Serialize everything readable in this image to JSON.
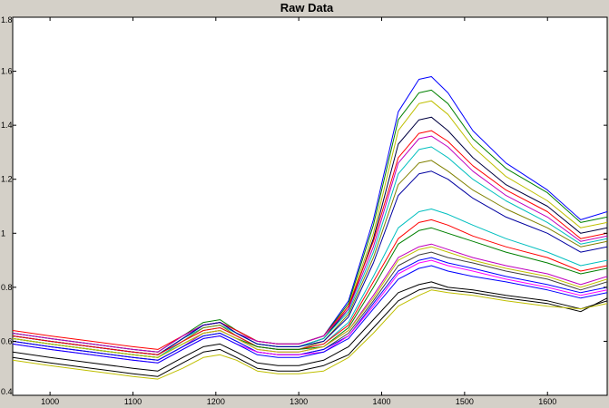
{
  "chart_data": {
    "type": "line",
    "title": "Raw Data",
    "xlabel": "",
    "ylabel": "",
    "xlim": [
      955,
      1672
    ],
    "ylim": [
      0.4,
      1.8
    ],
    "xticks": [
      1000,
      1100,
      1200,
      1300,
      1400,
      1500,
      1600
    ],
    "yticks": [
      0.4,
      0.6,
      0.8,
      1,
      1.2,
      1.4,
      1.6,
      1.8
    ],
    "xtick_labels": [
      "1000",
      "1100",
      "1200",
      "1300",
      "1400",
      "1500",
      "1600"
    ],
    "ytick_labels": [
      "0.4",
      "0.6",
      "0.8",
      "1",
      "1.2",
      "1.4",
      "1.6",
      "1.8"
    ],
    "x": [
      955,
      1000,
      1050,
      1100,
      1130,
      1160,
      1185,
      1205,
      1225,
      1250,
      1275,
      1300,
      1330,
      1360,
      1390,
      1420,
      1445,
      1460,
      1480,
      1510,
      1550,
      1600,
      1640,
      1672
    ],
    "grid": false,
    "legend": "none",
    "series": [
      {
        "color": "#0000ff",
        "values": [
          0.63,
          0.61,
          0.59,
          0.57,
          0.56,
          0.62,
          0.66,
          0.67,
          0.64,
          0.6,
          0.59,
          0.59,
          0.62,
          0.75,
          1.05,
          1.45,
          1.57,
          1.58,
          1.52,
          1.38,
          1.26,
          1.16,
          1.05,
          1.08
        ]
      },
      {
        "color": "#008000",
        "values": [
          0.63,
          0.61,
          0.59,
          0.57,
          0.56,
          0.62,
          0.67,
          0.68,
          0.64,
          0.6,
          0.59,
          0.59,
          0.62,
          0.74,
          1.03,
          1.42,
          1.52,
          1.53,
          1.48,
          1.35,
          1.24,
          1.15,
          1.04,
          1.06
        ]
      },
      {
        "color": "#bfbf00",
        "values": [
          0.62,
          0.6,
          0.58,
          0.56,
          0.55,
          0.61,
          0.66,
          0.67,
          0.63,
          0.59,
          0.58,
          0.58,
          0.61,
          0.73,
          1.0,
          1.38,
          1.48,
          1.49,
          1.44,
          1.32,
          1.21,
          1.12,
          1.02,
          1.04
        ]
      },
      {
        "color": "#000040",
        "values": [
          0.62,
          0.6,
          0.58,
          0.56,
          0.55,
          0.61,
          0.66,
          0.67,
          0.63,
          0.59,
          0.58,
          0.58,
          0.61,
          0.72,
          0.98,
          1.33,
          1.42,
          1.43,
          1.38,
          1.28,
          1.18,
          1.1,
          1.0,
          1.02
        ]
      },
      {
        "color": "#ff0000",
        "values": [
          0.64,
          0.62,
          0.6,
          0.58,
          0.57,
          0.62,
          0.66,
          0.67,
          0.64,
          0.6,
          0.59,
          0.59,
          0.62,
          0.73,
          0.97,
          1.28,
          1.37,
          1.38,
          1.34,
          1.25,
          1.16,
          1.08,
          0.98,
          1.0
        ]
      },
      {
        "color": "#bf00bf",
        "values": [
          0.63,
          0.61,
          0.59,
          0.57,
          0.56,
          0.62,
          0.66,
          0.67,
          0.63,
          0.6,
          0.59,
          0.59,
          0.62,
          0.72,
          0.95,
          1.26,
          1.35,
          1.36,
          1.32,
          1.23,
          1.14,
          1.06,
          0.97,
          0.99
        ]
      },
      {
        "color": "#00bfbf",
        "values": [
          0.62,
          0.6,
          0.58,
          0.56,
          0.55,
          0.61,
          0.65,
          0.66,
          0.63,
          0.59,
          0.58,
          0.58,
          0.61,
          0.71,
          0.93,
          1.22,
          1.31,
          1.32,
          1.28,
          1.2,
          1.12,
          1.04,
          0.96,
          0.98
        ]
      },
      {
        "color": "#808000",
        "values": [
          0.61,
          0.59,
          0.57,
          0.55,
          0.54,
          0.6,
          0.65,
          0.66,
          0.62,
          0.58,
          0.57,
          0.57,
          0.6,
          0.7,
          0.91,
          1.18,
          1.26,
          1.27,
          1.23,
          1.16,
          1.09,
          1.02,
          0.95,
          0.97
        ]
      },
      {
        "color": "#0000a0",
        "values": [
          0.62,
          0.6,
          0.58,
          0.56,
          0.55,
          0.61,
          0.66,
          0.67,
          0.63,
          0.59,
          0.58,
          0.58,
          0.6,
          0.69,
          0.89,
          1.14,
          1.22,
          1.23,
          1.2,
          1.13,
          1.06,
          1.0,
          0.93,
          0.95
        ]
      },
      {
        "color": "#00bfbf",
        "values": [
          0.61,
          0.59,
          0.57,
          0.55,
          0.54,
          0.6,
          0.64,
          0.65,
          0.62,
          0.58,
          0.57,
          0.57,
          0.59,
          0.67,
          0.84,
          1.02,
          1.08,
          1.09,
          1.07,
          1.03,
          0.98,
          0.93,
          0.88,
          0.9
        ]
      },
      {
        "color": "#ff0000",
        "values": [
          0.62,
          0.6,
          0.58,
          0.56,
          0.55,
          0.6,
          0.64,
          0.65,
          0.62,
          0.58,
          0.57,
          0.57,
          0.59,
          0.66,
          0.82,
          0.98,
          1.04,
          1.05,
          1.03,
          0.99,
          0.95,
          0.91,
          0.86,
          0.88
        ]
      },
      {
        "color": "#008000",
        "values": [
          0.61,
          0.59,
          0.57,
          0.55,
          0.54,
          0.59,
          0.63,
          0.64,
          0.61,
          0.58,
          0.57,
          0.57,
          0.58,
          0.65,
          0.8,
          0.96,
          1.01,
          1.02,
          1.0,
          0.97,
          0.93,
          0.89,
          0.85,
          0.87
        ]
      },
      {
        "color": "#bf00bf",
        "values": [
          0.6,
          0.58,
          0.56,
          0.54,
          0.53,
          0.58,
          0.63,
          0.64,
          0.61,
          0.57,
          0.56,
          0.56,
          0.58,
          0.64,
          0.77,
          0.91,
          0.95,
          0.96,
          0.94,
          0.91,
          0.88,
          0.85,
          0.81,
          0.84
        ]
      },
      {
        "color": "#bfbf00",
        "values": [
          0.61,
          0.59,
          0.57,
          0.55,
          0.54,
          0.59,
          0.63,
          0.64,
          0.61,
          0.57,
          0.56,
          0.56,
          0.58,
          0.64,
          0.76,
          0.9,
          0.94,
          0.95,
          0.93,
          0.9,
          0.87,
          0.84,
          0.8,
          0.83
        ]
      },
      {
        "color": "#404040",
        "values": [
          0.6,
          0.58,
          0.56,
          0.54,
          0.53,
          0.58,
          0.62,
          0.63,
          0.6,
          0.56,
          0.55,
          0.55,
          0.57,
          0.63,
          0.75,
          0.88,
          0.92,
          0.93,
          0.91,
          0.89,
          0.86,
          0.83,
          0.79,
          0.82
        ]
      },
      {
        "color": "#0000ff",
        "values": [
          0.6,
          0.58,
          0.56,
          0.54,
          0.53,
          0.58,
          0.62,
          0.63,
          0.6,
          0.56,
          0.55,
          0.55,
          0.57,
          0.62,
          0.74,
          0.86,
          0.9,
          0.91,
          0.89,
          0.87,
          0.84,
          0.81,
          0.78,
          0.8
        ]
      },
      {
        "color": "#ff00ff",
        "values": [
          0.59,
          0.57,
          0.55,
          0.53,
          0.52,
          0.57,
          0.61,
          0.62,
          0.59,
          0.56,
          0.55,
          0.55,
          0.56,
          0.62,
          0.73,
          0.85,
          0.89,
          0.9,
          0.88,
          0.86,
          0.83,
          0.8,
          0.77,
          0.79
        ]
      },
      {
        "color": "#0000ff",
        "values": [
          0.59,
          0.57,
          0.55,
          0.53,
          0.52,
          0.57,
          0.61,
          0.62,
          0.59,
          0.55,
          0.54,
          0.54,
          0.56,
          0.61,
          0.72,
          0.83,
          0.87,
          0.88,
          0.86,
          0.84,
          0.82,
          0.79,
          0.76,
          0.78
        ]
      },
      {
        "color": "#000000",
        "values": [
          0.56,
          0.54,
          0.52,
          0.5,
          0.49,
          0.54,
          0.58,
          0.59,
          0.56,
          0.52,
          0.51,
          0.51,
          0.53,
          0.58,
          0.68,
          0.78,
          0.81,
          0.82,
          0.8,
          0.79,
          0.77,
          0.75,
          0.72,
          0.75
        ]
      },
      {
        "color": "#000000",
        "values": [
          0.54,
          0.52,
          0.5,
          0.48,
          0.47,
          0.52,
          0.56,
          0.57,
          0.54,
          0.5,
          0.49,
          0.49,
          0.51,
          0.55,
          0.65,
          0.75,
          0.79,
          0.8,
          0.79,
          0.78,
          0.76,
          0.74,
          0.71,
          0.76
        ]
      },
      {
        "color": "#bfbf00",
        "values": [
          0.53,
          0.51,
          0.49,
          0.47,
          0.46,
          0.5,
          0.54,
          0.55,
          0.53,
          0.49,
          0.48,
          0.48,
          0.49,
          0.54,
          0.63,
          0.73,
          0.77,
          0.79,
          0.78,
          0.77,
          0.75,
          0.73,
          0.72,
          0.74
        ]
      }
    ]
  }
}
